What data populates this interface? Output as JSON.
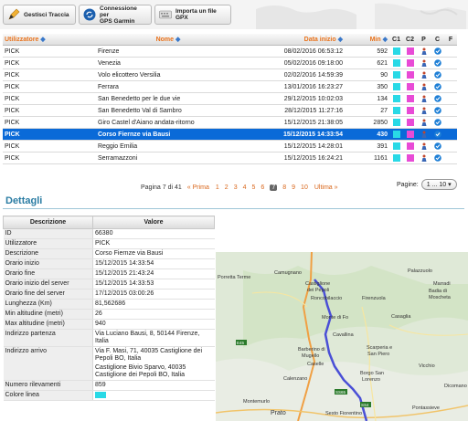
{
  "toolbar": {
    "manage_label": "Gestisci Traccia",
    "connect_label_1": "Connessione per",
    "connect_label_2": "GPS Garmin",
    "import_label": "Importa un file GPX"
  },
  "grid": {
    "headers": {
      "user": "Utilizzatore",
      "name": "Nome",
      "date": "Data inizio",
      "min": "Min",
      "c1": "C1",
      "c2": "C2",
      "p": "P",
      "c": "C",
      "f": "F"
    },
    "rows": [
      {
        "user": "PICK",
        "name": "Firenze",
        "date": "08/02/2016 06:53:12",
        "min": "592"
      },
      {
        "user": "PICK",
        "name": "Venezia",
        "date": "05/02/2016 09:18:00",
        "min": "621"
      },
      {
        "user": "PICK",
        "name": "Volo elicottero Versilia",
        "date": "02/02/2016 14:59:39",
        "min": "90"
      },
      {
        "user": "PICK",
        "name": "Ferrara",
        "date": "13/01/2016 16:23:27",
        "min": "350"
      },
      {
        "user": "PICK",
        "name": "San Benedetto per le due vie",
        "date": "29/12/2015 10:02:03",
        "min": "134"
      },
      {
        "user": "PICK",
        "name": "San Benedetto Val di Sambro",
        "date": "28/12/2015 11:27:16",
        "min": "27"
      },
      {
        "user": "PICK",
        "name": "Giro Castel d'Aiano andata-ritorno",
        "date": "15/12/2015 21:38:05",
        "min": "2850"
      },
      {
        "user": "PICK",
        "name": "Corso Fiernze via Bausi",
        "date": "15/12/2015 14:33:54",
        "min": "430"
      },
      {
        "user": "PICK",
        "name": "Reggio Emilia",
        "date": "15/12/2015 14:28:01",
        "min": "391"
      },
      {
        "user": "PICK",
        "name": "Serramazzoni",
        "date": "15/12/2015 16:24:21",
        "min": "1161"
      }
    ],
    "selected_index": 7,
    "colors": {
      "c1": "#29d9e6",
      "c2": "#e84bd6",
      "check": "#1e7fd6"
    }
  },
  "pager": {
    "text": "Pagina 7 di 41",
    "first": "Prima",
    "pages": [
      "1",
      "2",
      "3",
      "4",
      "5",
      "6",
      "7",
      "8",
      "9",
      "10"
    ],
    "current": "7",
    "last": "Ultima",
    "pages_label": "Pagine:",
    "pages_select": "1 ... 10"
  },
  "details": {
    "title": "Dettagli",
    "headers": {
      "desc": "Descrizione",
      "value": "Valore"
    },
    "rows": [
      {
        "label": "ID",
        "value": "66380"
      },
      {
        "label": "Utilizzatore",
        "value": "PICK"
      },
      {
        "label": "Descrizione",
        "value": "Corso Fiernze via Bausi"
      },
      {
        "label": "Orario inizio",
        "value": "15/12/2015 14:33:54"
      },
      {
        "label": "Orario fine",
        "value": "15/12/2015 21:43:24"
      },
      {
        "label": "Orario inizio del server",
        "value": "15/12/2015 14:33:53"
      },
      {
        "label": "Orario fine del server",
        "value": "17/12/2015 03:00:26"
      },
      {
        "label": "Lunghezza (Km)",
        "value": "81,562686"
      },
      {
        "label": "Min altitudine (metri)",
        "value": "26"
      },
      {
        "label": "Max altitudine (metri)",
        "value": "940"
      },
      {
        "label": "Indirizzo partenza",
        "value": "Via Luciano Bausi, 8, 50144 Firenze, Italia"
      },
      {
        "label": "Indirizzo arrivo",
        "value": "Via F. Masi, 71, 40035 Castiglione dei Pepoli BO, Italia",
        "value2": "Castiglione Bivio Sparvo, 40035 Castiglione dei Pepoli BO, Italia"
      },
      {
        "label": "Numero rilevamenti",
        "value": "859"
      },
      {
        "label": "Colore linea",
        "value": ""
      }
    ]
  },
  "map": {
    "towns": [
      "Castiglione dei Pepoli",
      "Roncobilaccio",
      "Camugnano",
      "Porretta Terme",
      "Firenzuola",
      "Badia di Moscheta",
      "Monte di Fo",
      "Barberino di Mugello",
      "Borgo San Lorenzo",
      "Scarperia e San Piero",
      "Vicchio",
      "Dicomano",
      "Pontassieve",
      "Prato",
      "Montemurlo",
      "Sesto Fiorentino",
      "Calenzano",
      "Marradi",
      "Palazzuolo",
      "Casaglia",
      "Cavallina",
      "Caselle"
    ],
    "roads": [
      "E45",
      "SS65",
      "SS4"
    ]
  }
}
